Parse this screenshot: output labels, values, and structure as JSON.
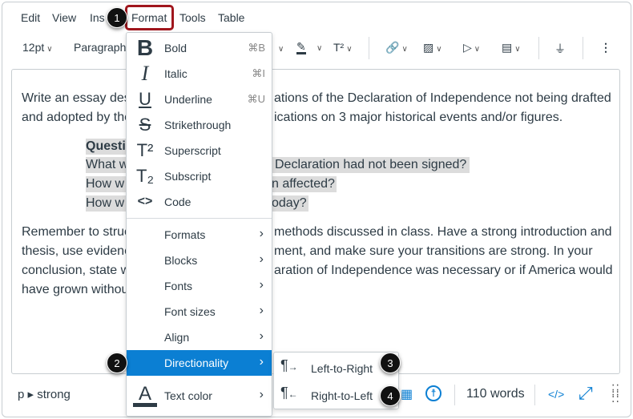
{
  "menubar": {
    "items": [
      "Edit",
      "View",
      "Ins",
      "Format",
      "Tools",
      "Table"
    ]
  },
  "toolbar": {
    "font_size": "12pt",
    "block": "Paragraph",
    "superscript": "T²"
  },
  "editor": {
    "lines": [
      [
        "Write an essay des",
        "ations of the Declaration of Independence not being drafted"
      ],
      [
        "and adopted by the",
        "ications on 3 major historical events and/or figures."
      ],
      [
        "Questi",
        ""
      ],
      [
        "What w",
        "Declaration had not been signed?"
      ],
      [
        "How w",
        "n affected?"
      ],
      [
        "How w",
        "oday?"
      ],
      [
        "Remember to struc",
        "methods discussed in class. Have a strong introduction and"
      ],
      [
        "thesis, use evidenc",
        "ment, and make sure your transitions are strong. In your"
      ],
      [
        "conclusion, state w",
        "aration of Independence was necessary or if America would"
      ],
      [
        "have grown withou",
        ""
      ]
    ]
  },
  "format_menu": {
    "items": [
      {
        "label": "Bold",
        "shortcut": "⌘B",
        "icon": "B"
      },
      {
        "label": "Italic",
        "shortcut": "⌘I",
        "icon": "I"
      },
      {
        "label": "Underline",
        "shortcut": "⌘U",
        "icon": "U"
      },
      {
        "label": "Strikethrough",
        "icon": "S"
      },
      {
        "label": "Superscript",
        "icon": "T²"
      },
      {
        "label": "Subscript",
        "icon": "T₂"
      },
      {
        "label": "Code",
        "icon": "<>"
      }
    ],
    "submenus": [
      "Formats",
      "Blocks",
      "Fonts",
      "Font sizes",
      "Align",
      "Directionality",
      "Text color"
    ],
    "text_color_icon": "A"
  },
  "directionality_menu": {
    "items": [
      "Left-to-Right",
      "Right-to-Left"
    ]
  },
  "statusbar": {
    "path": "p ▸ strong",
    "word_count": "110 words",
    "html_toggle": "</>"
  },
  "callouts": [
    "1",
    "2",
    "3",
    "4"
  ],
  "colors": {
    "accent": "#0b7fd3",
    "callout_border": "#a0161d"
  }
}
